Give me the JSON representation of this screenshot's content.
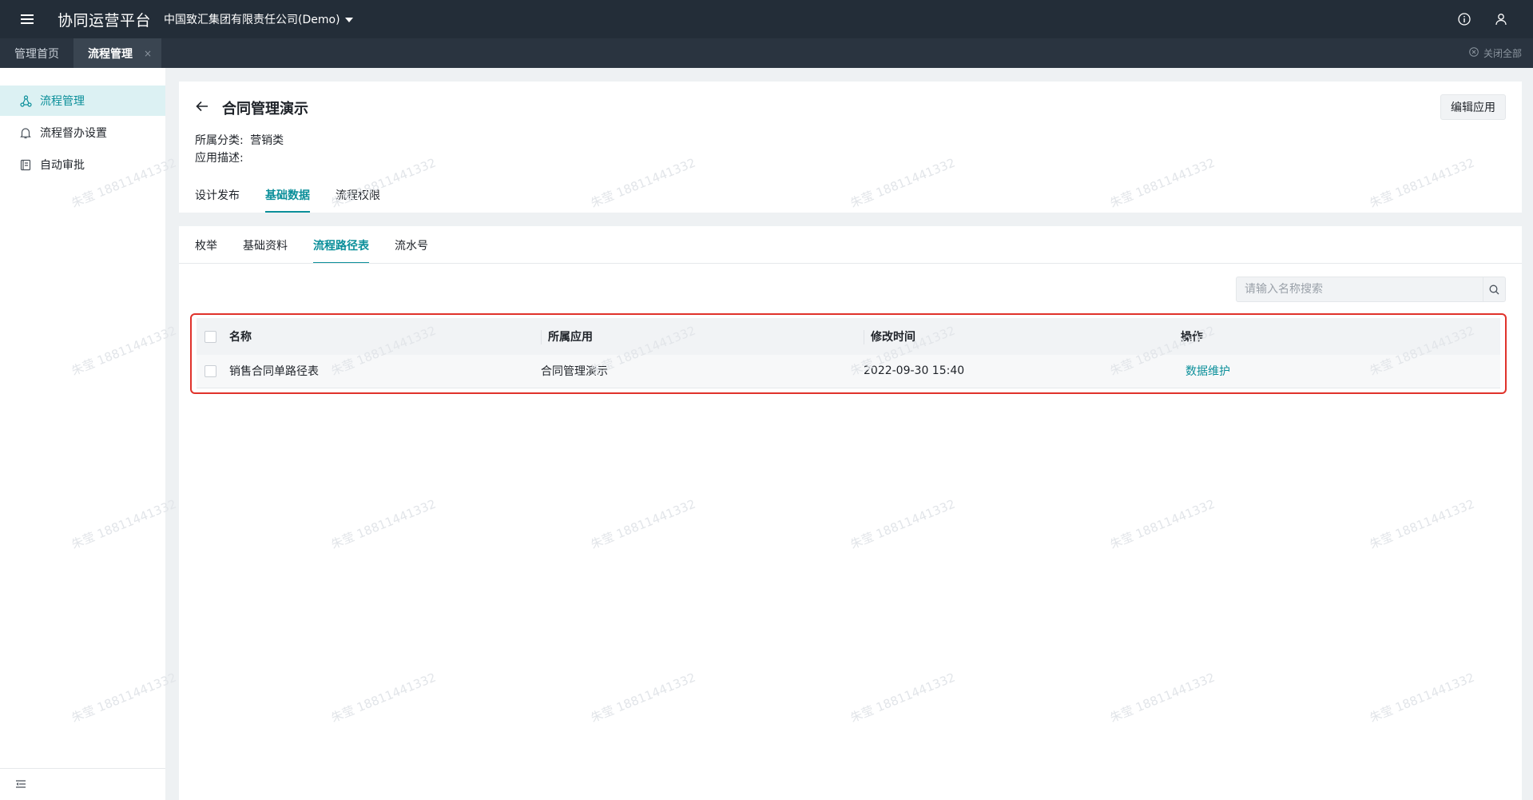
{
  "topbar": {
    "app_title": "协同运营平台",
    "org_name": "中国致汇集团有限责任公司(Demo)"
  },
  "page_tabs": [
    {
      "label": "管理首页",
      "active": false
    },
    {
      "label": "流程管理",
      "active": true
    }
  ],
  "tab_close_glyph": "×",
  "close_all_label": "关闭全部",
  "sidebar": {
    "items": [
      {
        "label": "流程管理",
        "icon": "flow-icon",
        "active": true
      },
      {
        "label": "流程督办设置",
        "icon": "bell-icon",
        "active": false
      },
      {
        "label": "自动审批",
        "icon": "book-icon",
        "active": false
      }
    ]
  },
  "header": {
    "title": "合同管理演示",
    "category_label": "所属分类:",
    "category_value": "营销类",
    "desc_label": "应用描述:",
    "desc_value": "",
    "edit_label": "编辑应用",
    "tabs": [
      "设计发布",
      "基础数据",
      "流程权限"
    ],
    "active_tab": "基础数据"
  },
  "content": {
    "tabs": [
      "枚举",
      "基础资料",
      "流程路径表",
      "流水号"
    ],
    "active_tab": "流程路径表",
    "search_placeholder": "请输入名称搜索",
    "table": {
      "columns": [
        "名称",
        "所属应用",
        "修改时间",
        "操作"
      ],
      "rows": [
        {
          "name": "销售合同单路径表",
          "app": "合同管理演示",
          "modified": "2022-09-30 15:40",
          "action": "数据维护"
        }
      ]
    }
  },
  "watermark_text": "朱莹 18811441332",
  "colors": {
    "accent": "#0b8f9a",
    "topbar": "#232d38",
    "highlight_border": "#e0322b"
  }
}
